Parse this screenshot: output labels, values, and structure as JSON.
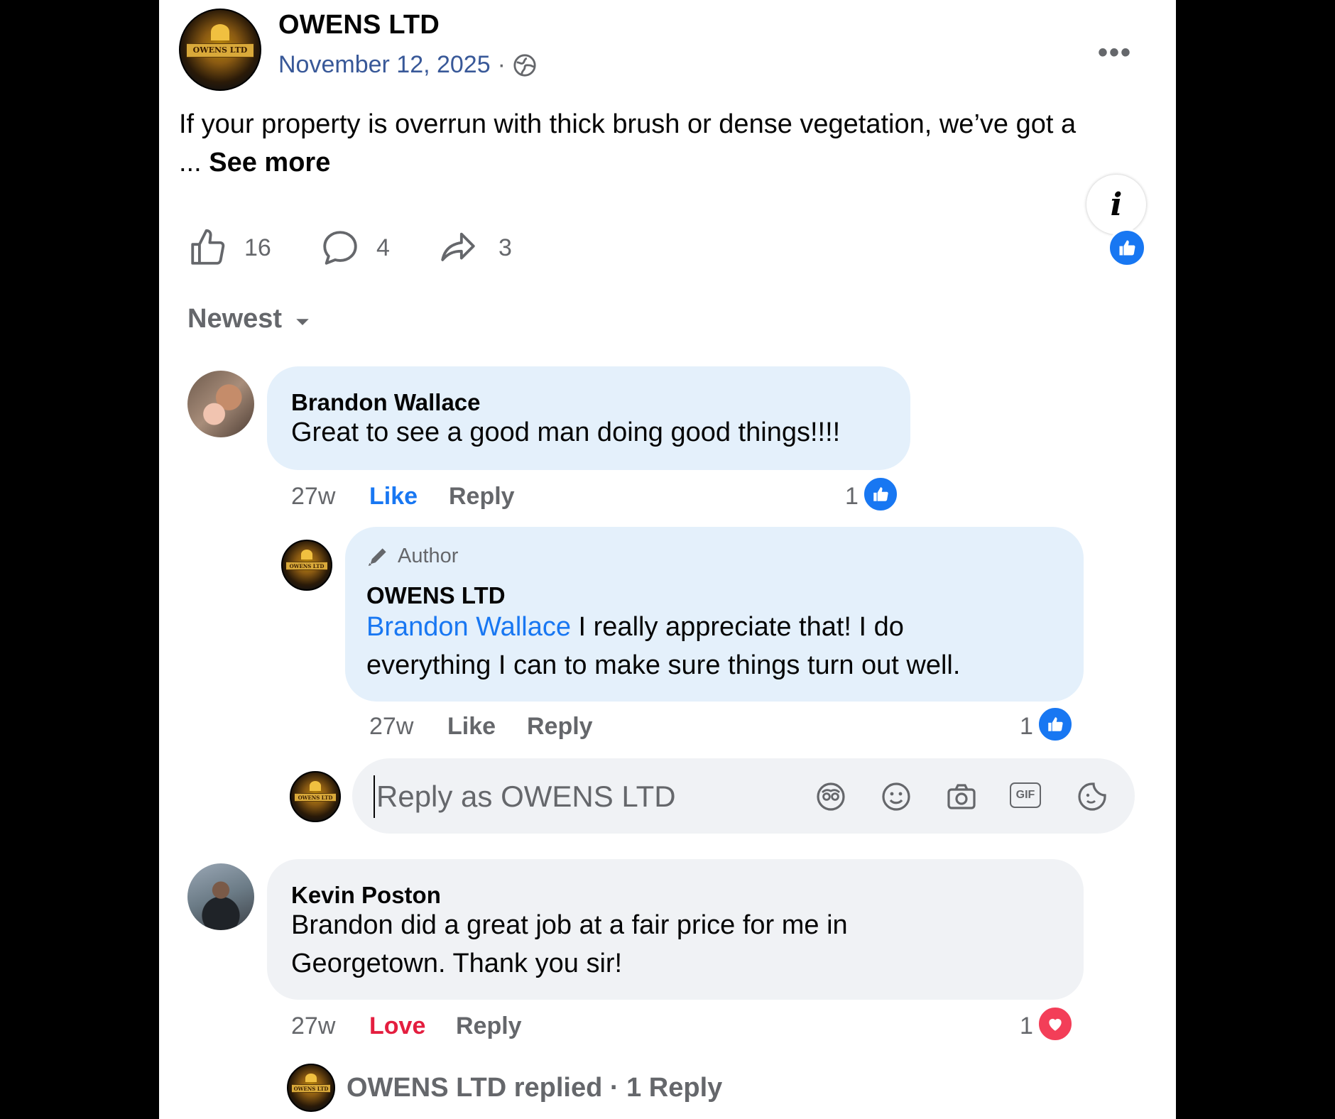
{
  "post": {
    "page_name": "OWENS LTD",
    "date": "November 12, 2025",
    "separator": "·",
    "text_line1": "If your property is overrun with thick brush or dense vegetation, we’ve got a",
    "ellipsis": "...",
    "see_more": "See more",
    "likes": "16",
    "comments": "4",
    "shares": "3",
    "info_icon_label": "i",
    "more_options": "•••",
    "avatar_text": "OWENS LTD"
  },
  "sort": {
    "label": "Newest"
  },
  "comments": [
    {
      "author": "Brandon Wallace",
      "text": "Great to see a good man doing good things!!!!",
      "time": "27w",
      "like_label": "Like",
      "reply_label": "Reply",
      "reaction_count": "1",
      "reaction": "like"
    },
    {
      "badge": "Author",
      "author": "OWENS LTD",
      "mention": "Brandon Wallace",
      "text_after_mention": " I really appreciate that! I do",
      "text_line2": "everything I can to make sure things turn out well.",
      "time": "27w",
      "like_label": "Like",
      "reply_label": "Reply",
      "reaction_count": "1",
      "reaction": "like"
    },
    {
      "author": "Kevin Poston",
      "text_line1": "Brandon did a great job at a fair price for me in",
      "text_line2": "Georgetown. Thank you sir!",
      "time": "27w",
      "love_label": "Love",
      "reply_label": "Reply",
      "reaction_count": "1",
      "reaction": "love"
    }
  ],
  "reply_box": {
    "placeholder": "Reply as OWENS LTD",
    "icons": [
      "avatar-sticker-icon",
      "emoji-icon",
      "camera-icon",
      "gif-icon",
      "sticker-icon"
    ],
    "gif_text": "GIF"
  },
  "replied": {
    "text": "OWENS LTD replied · 1 Reply"
  },
  "colors": {
    "accent": "#1877f2",
    "love": "#e41e3f",
    "bubble_blue": "#e4f0fb",
    "bubble_gray": "#f0f2f5",
    "secondary_text": "#65676b"
  }
}
